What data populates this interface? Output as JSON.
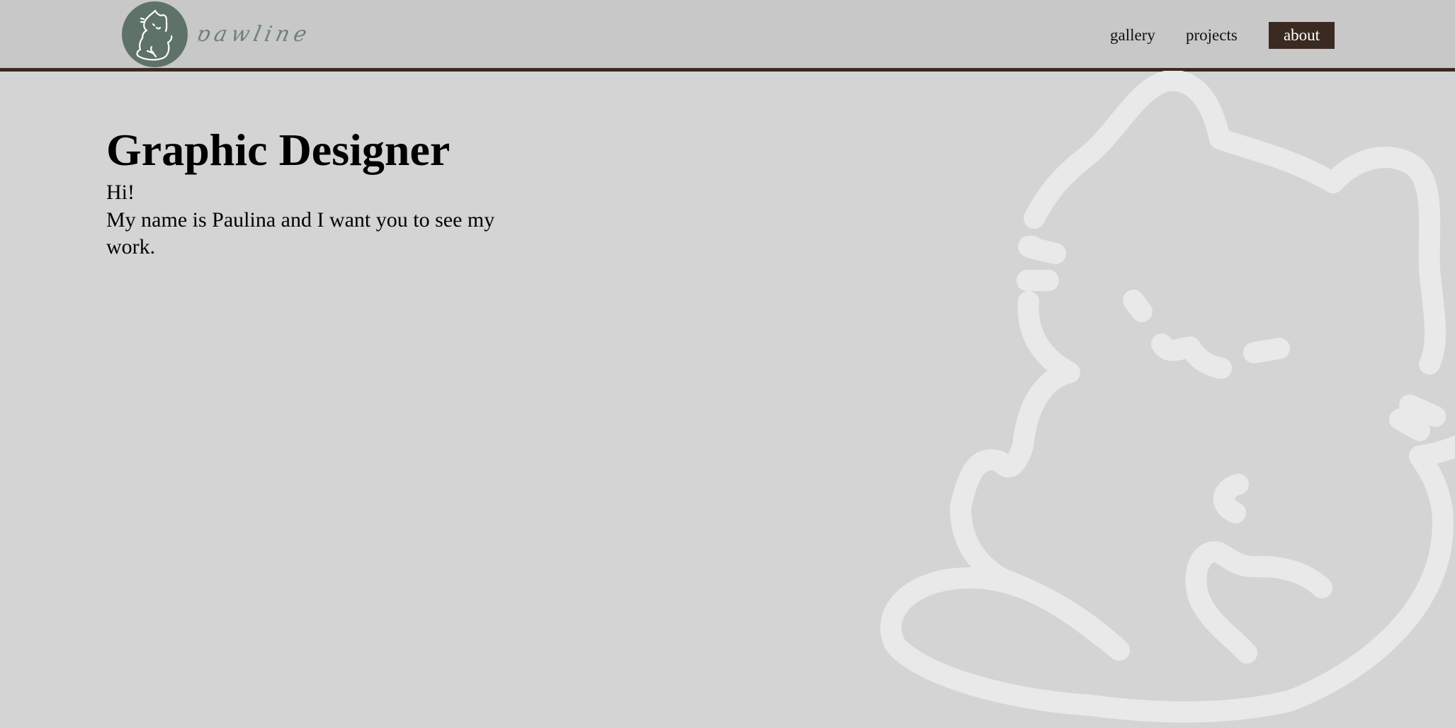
{
  "header": {
    "logo": {
      "icon": "cat-logo-icon",
      "wordmark": "pawline",
      "circle_color": "#5f7268"
    },
    "nav": {
      "items": [
        {
          "label": "gallery",
          "active": false
        },
        {
          "label": "projects",
          "active": false
        },
        {
          "label": "about",
          "active": true
        }
      ]
    },
    "border_color": "#3a2a22"
  },
  "hero": {
    "title": "Graphic Designer",
    "greeting": "Hi!",
    "intro": "My name is Paulina and I want you to see my work."
  },
  "background": {
    "illustration": "cat-outline-illustration",
    "color": "#d4d4d4"
  }
}
